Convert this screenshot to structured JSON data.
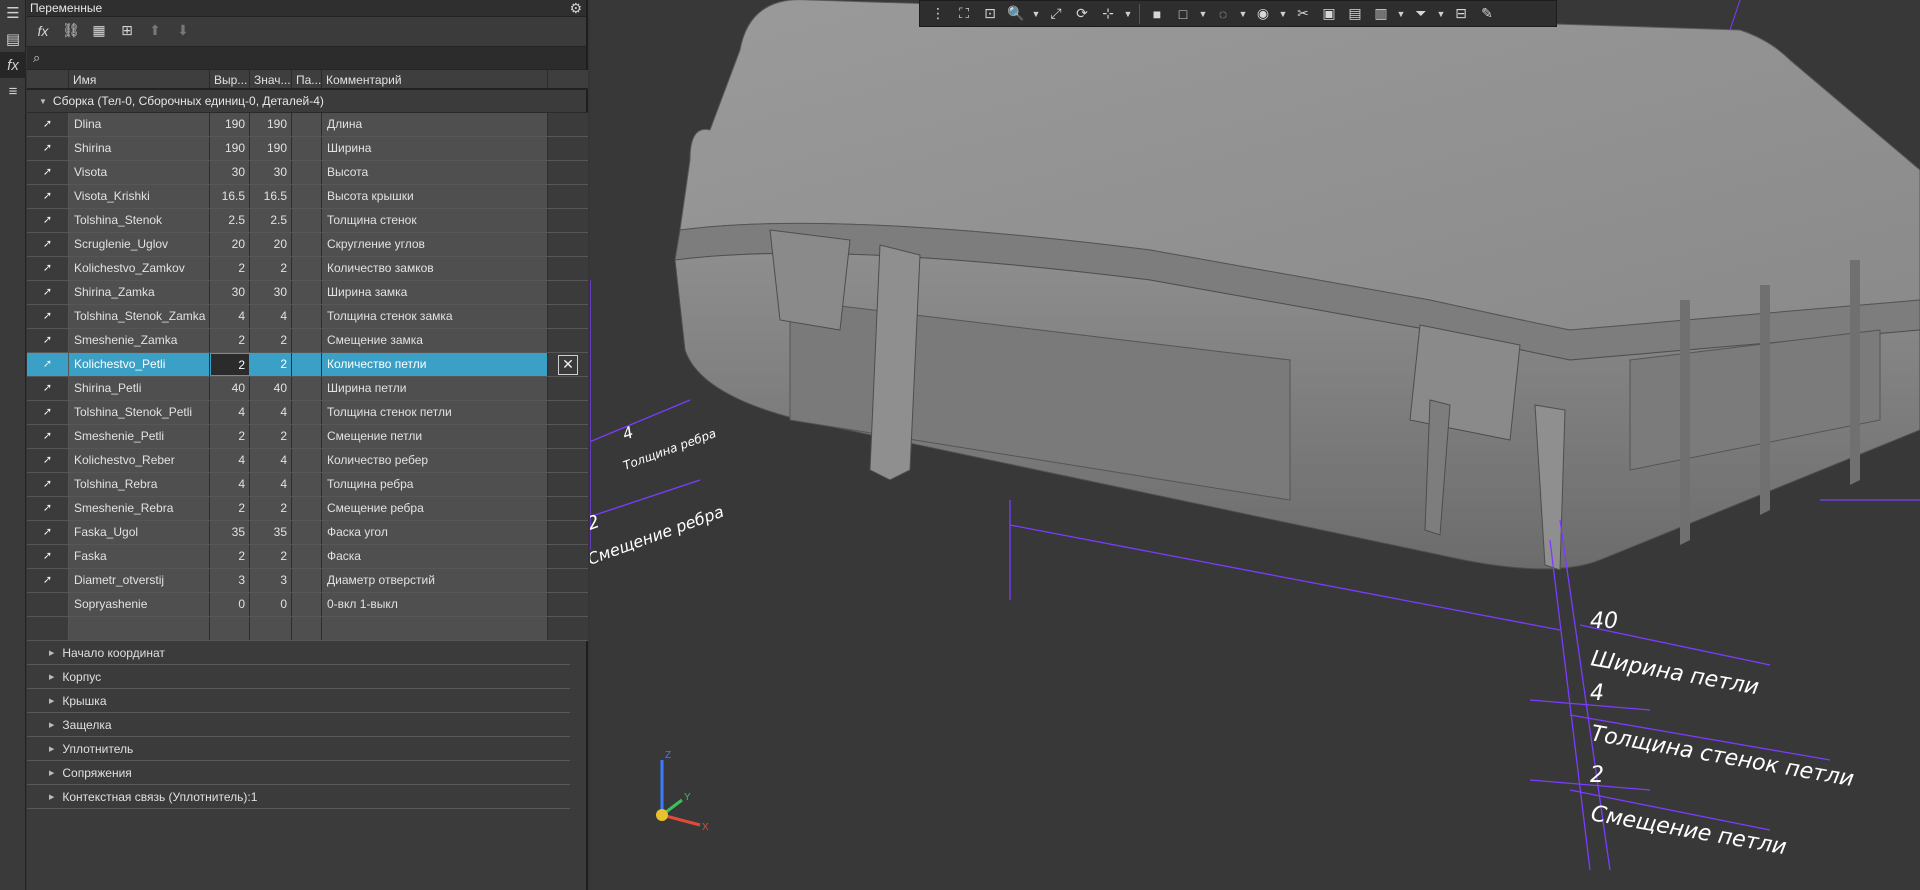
{
  "panel": {
    "title": "Переменные",
    "search_placeholder": "",
    "columns": [
      "Имя",
      "Выр...",
      "Знач...",
      "Па...",
      "Комментарий"
    ],
    "assembly_group": "Сборка (Тел-0, Сборочных единиц-0, Деталей-4)",
    "variables": [
      {
        "name": "Dlina",
        "expr": "190",
        "value": "190",
        "comment": "Длина"
      },
      {
        "name": "Shirina",
        "expr": "190",
        "value": "190",
        "comment": "Ширина"
      },
      {
        "name": "Visota",
        "expr": "30",
        "value": "30",
        "comment": "Высота"
      },
      {
        "name": "Visota_Krishki",
        "expr": "16.5",
        "value": "16.5",
        "comment": "Высота крышки"
      },
      {
        "name": "Tolshina_Stenok",
        "expr": "2.5",
        "value": "2.5",
        "comment": "Толщина стенок"
      },
      {
        "name": "Scruglenie_Uglov",
        "expr": "20",
        "value": "20",
        "comment": "Скругление углов"
      },
      {
        "name": "Kolichestvo_Zamkov",
        "expr": "2",
        "value": "2",
        "comment": "Количество замков"
      },
      {
        "name": "Shirina_Zamka",
        "expr": "30",
        "value": "30",
        "comment": "Ширина замка"
      },
      {
        "name": "Tolshina_Stenok_Zamka",
        "expr": "4",
        "value": "4",
        "comment": "Толщина стенок замка"
      },
      {
        "name": "Smeshenie_Zamka",
        "expr": "2",
        "value": "2",
        "comment": "Смещение замка"
      },
      {
        "name": "Kolichestvo_Petli",
        "expr": "2",
        "value": "2",
        "comment": "Количество петли"
      },
      {
        "name": "Shirina_Petli",
        "expr": "40",
        "value": "40",
        "comment": "Ширина петли"
      },
      {
        "name": "Tolshina_Stenok_Petli",
        "expr": "4",
        "value": "4",
        "comment": "Толщина стенок петли"
      },
      {
        "name": "Smeshenie_Petli",
        "expr": "2",
        "value": "2",
        "comment": "Смещение петли"
      },
      {
        "name": "Kolichestvo_Reber",
        "expr": "4",
        "value": "4",
        "comment": "Количество ребер"
      },
      {
        "name": "Tolshina_Rebra",
        "expr": "4",
        "value": "4",
        "comment": "Толщина ребра"
      },
      {
        "name": "Smeshenie_Rebra",
        "expr": "2",
        "value": "2",
        "comment": "Смещение ребра"
      },
      {
        "name": "Faska_Ugol",
        "expr": "35",
        "value": "35",
        "comment": "Фаска угол"
      },
      {
        "name": "Faska",
        "expr": "2",
        "value": "2",
        "comment": "Фаска"
      },
      {
        "name": "Diametr_otverstij",
        "expr": "3",
        "value": "3",
        "comment": "Диаметр отверстий"
      },
      {
        "name": "Sopryashenie",
        "expr": "0",
        "value": "0",
        "comment": "0-вкл 1-выкл"
      }
    ],
    "subgroups": [
      "Начало координат",
      "Корпус",
      "Крышка",
      "Защелка",
      "Уплотнитель",
      "Сопряжения",
      "Контекстная связь (Уплотнитель):1"
    ]
  },
  "viewport": {
    "dimensions": [
      {
        "value": "40",
        "label": "Ширина петли"
      },
      {
        "value": "4",
        "label": "Толщина стенок петли"
      },
      {
        "value": "2",
        "label": "Смещение петли"
      },
      {
        "value": "4",
        "label": "Толщина ребра"
      },
      {
        "value": "2",
        "label": "Смещение ребра"
      }
    ],
    "triad": {
      "x": "X",
      "y": "Y",
      "z": "Z"
    },
    "colors": {
      "dimension": "#7b3cff",
      "model": "#8c8c8c",
      "selection": "#3aa0c6"
    }
  }
}
